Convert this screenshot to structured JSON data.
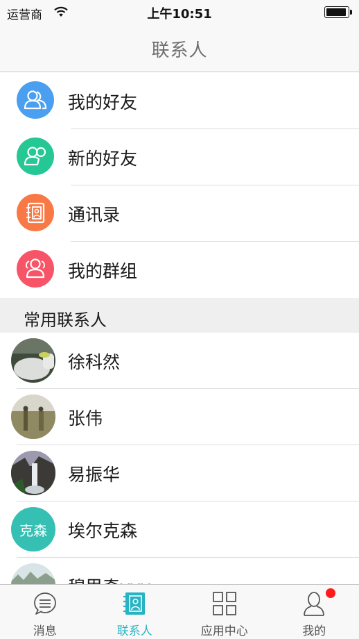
{
  "status_bar": {
    "carrier": "运营商",
    "time": "上午10:51",
    "battery_level": 0.92
  },
  "nav": {
    "title": "联系人"
  },
  "menu_items": [
    {
      "label": "我的好友",
      "icon": "friends-icon",
      "color": "#4a9ff0"
    },
    {
      "label": "新的好友",
      "icon": "add-friend-icon",
      "color": "#25c794"
    },
    {
      "label": "通讯录",
      "icon": "address-book-icon",
      "color": "#f87945"
    },
    {
      "label": "我的群组",
      "icon": "group-icon",
      "color": "#f75567"
    }
  ],
  "section": {
    "frequent_title": "常用联系人"
  },
  "contacts": [
    {
      "name": "徐科然",
      "avatar": "photo-avatar"
    },
    {
      "name": "张伟",
      "avatar": "photo-avatar"
    },
    {
      "name": "易振华",
      "avatar": "photo-avatar"
    },
    {
      "name": "埃尔克森",
      "avatar": "text-avatar",
      "avatar_text": "克森",
      "avatar_color": "#35c0b3"
    },
    {
      "name": "穆里奇vvv",
      "avatar": "photo-avatar"
    }
  ],
  "tabs": [
    {
      "label": "消息",
      "icon": "message-icon",
      "active": false
    },
    {
      "label": "联系人",
      "icon": "contacts-book-icon",
      "active": true
    },
    {
      "label": "应用中心",
      "icon": "app-grid-icon",
      "active": false
    },
    {
      "label": "我的",
      "icon": "profile-icon",
      "active": false,
      "badge": true
    }
  ],
  "colors": {
    "accent": "#27b3c3",
    "badge": "#ff1a1a"
  }
}
